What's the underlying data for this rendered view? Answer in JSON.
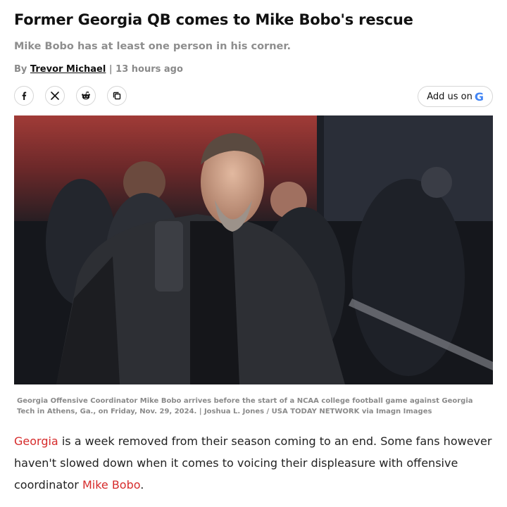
{
  "article": {
    "headline": "Former Georgia QB comes to Mike Bobo's rescue",
    "subheadline": "Mike Bobo has at least one person in his corner.",
    "byline": {
      "prefix": "By",
      "author": "Trevor Michael",
      "separator": "|",
      "time": "13 hours ago"
    }
  },
  "share": {
    "buttons": [
      {
        "name": "facebook-icon",
        "glyph": "f"
      },
      {
        "name": "x-icon",
        "glyph": "X"
      },
      {
        "name": "reddit-icon",
        "glyph": "reddit"
      },
      {
        "name": "copy-link-icon",
        "glyph": "copy"
      }
    ],
    "add_us_label": "Add us on",
    "add_us_logo": "G"
  },
  "photo": {
    "caption": "Georgia Offensive Coordinator Mike Bobo arrives before the start of a NCAA college football game against Georgia Tech in Athens, Ga., on Friday, Nov. 29, 2024. | Joshua L. Jones / USA TODAY NETWORK via Imagn Images"
  },
  "body": {
    "link1": "Georgia",
    "text1": " is a week removed from their season coming to an end. Some fans however haven't slowed down when it comes to voicing their displeasure with offensive coordinator ",
    "link2": "Mike Bobo",
    "text2": "."
  },
  "colors": {
    "link": "#d62b2b",
    "muted": "#8e8e8e",
    "google_blue": "#4285F4",
    "google_red": "#EA4335",
    "google_yellow": "#FBBC05",
    "google_green": "#34A853"
  }
}
